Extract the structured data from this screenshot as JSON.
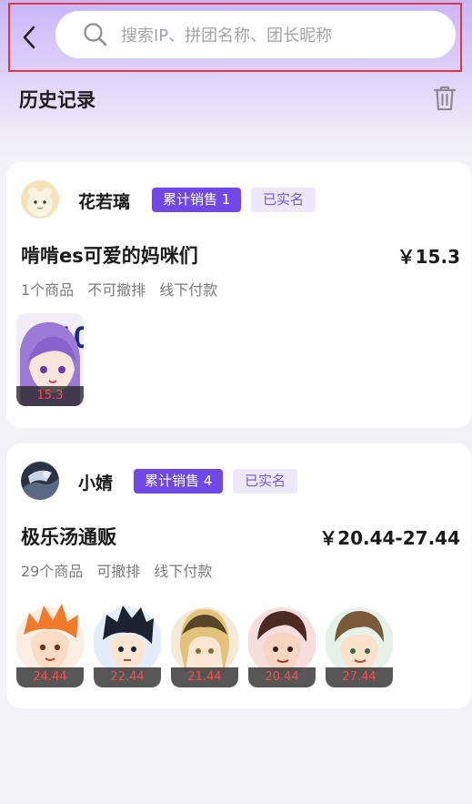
{
  "search": {
    "placeholder": "搜索IP、拼团名称、团长昵称"
  },
  "history": {
    "title": "历史记录"
  },
  "cards": [
    {
      "seller": "花若璃",
      "sales_badge": "累计销售 1",
      "verified_badge": "已实名",
      "group_title": "啃啃es可爱的妈咪们",
      "price": "￥15.3",
      "meta": [
        "1个商品",
        "不可撤排",
        "线下付款"
      ],
      "items": [
        {
          "price": "15.3"
        }
      ]
    },
    {
      "seller": "小婧",
      "sales_badge": "累计销售 4",
      "verified_badge": "已实名",
      "group_title": "极乐汤通贩",
      "price": "￥20.44-27.44",
      "meta": [
        "29个商品",
        "可撤排",
        "线下付款"
      ],
      "items": [
        {
          "price": "24.44"
        },
        {
          "price": "22.44"
        },
        {
          "price": "21.44"
        },
        {
          "price": "20.44"
        },
        {
          "price": "27.44"
        }
      ]
    }
  ],
  "colors": {
    "accent": "#7048e8",
    "price_label": "#ff4b4b",
    "highlight_border": "#e8343f"
  }
}
